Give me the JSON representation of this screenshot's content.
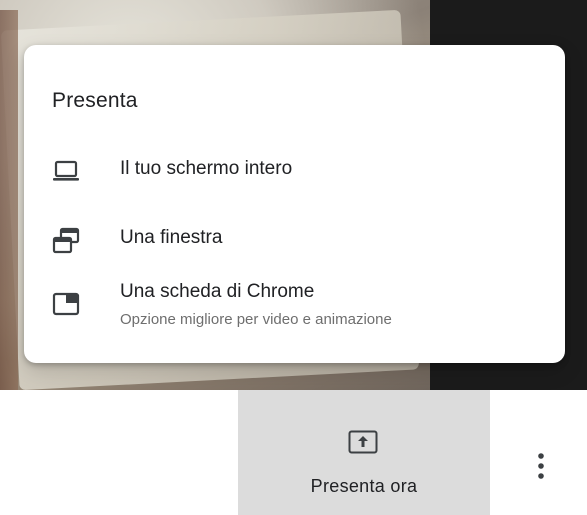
{
  "menu": {
    "title": "Presenta",
    "items": [
      {
        "label": "Il tuo schermo intero",
        "icon": "laptop-icon"
      },
      {
        "label": "Una finestra",
        "icon": "window-icon"
      },
      {
        "label": "Una scheda di Chrome",
        "sublabel": "Opzione migliore per video e animazione",
        "icon": "tab-icon"
      }
    ]
  },
  "controls": {
    "present_now_label": "Presenta ora",
    "present_now_icon": "present-upload-icon",
    "more_icon": "more-vert-icon"
  },
  "colors": {
    "text": "#202124",
    "subtext": "#6e6e6e",
    "button_bg": "#dcdcdc",
    "card_bg": "#ffffff"
  }
}
